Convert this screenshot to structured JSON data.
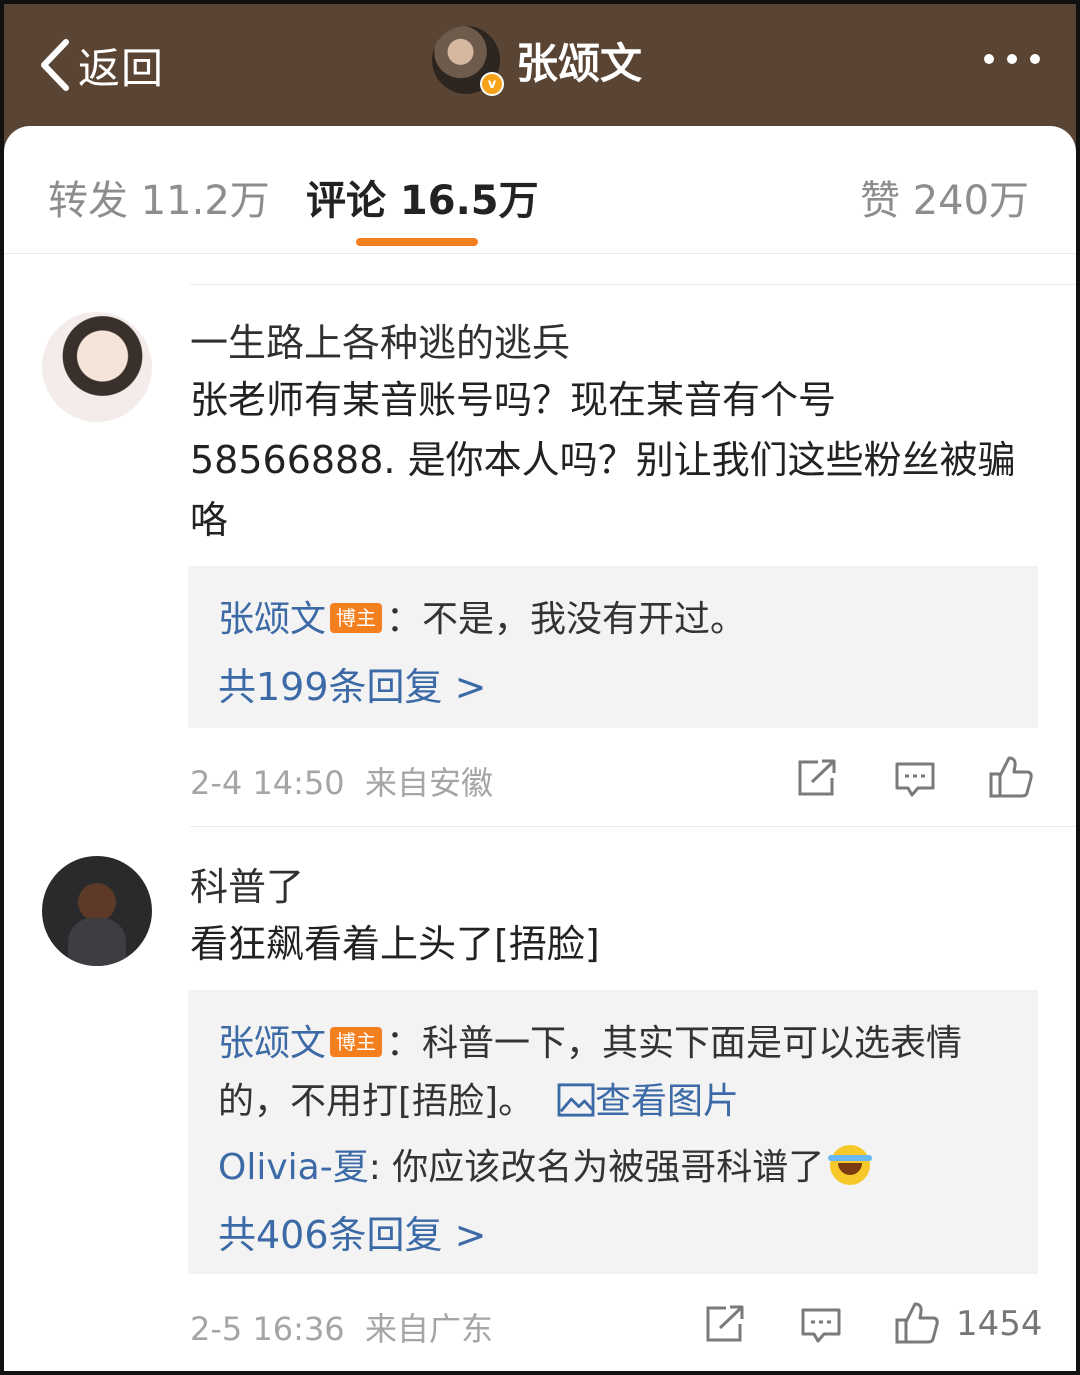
{
  "header": {
    "back_label": "返回",
    "profile_name": "张颂文",
    "verified_badge": "v"
  },
  "tabs": [
    {
      "label": "转发 11.2万"
    },
    {
      "label": "评论 16.5万"
    },
    {
      "label": "赞 240万"
    }
  ],
  "active_tab": "评论 16.5万",
  "comments": [
    {
      "username": "一生路上各种逃的逃兵",
      "content": "张老师有某音账号吗？现在某音有个号58566888. 是你本人吗？别让我们这些粉丝被骗咯",
      "reply_author": "张颂文",
      "reply_author_tag": "博主",
      "reply_text": "：不是，我没有开过。",
      "reply_count_link": "共199条回复 >",
      "timestamp": "2-4 14:50",
      "location": "来自安徽"
    },
    {
      "username": "科普了",
      "content": "看狂飙看着上头了[捂脸]",
      "reply_author": "张颂文",
      "reply_author_tag": "博主",
      "reply_text_line1": "：科普一下，其实下面是可以选表情",
      "reply_text_line2": "的，不用打[捂脸]。",
      "view_image_link": "查看图片",
      "sub_reply_author": "Olivia-夏",
      "sub_reply_text": ": 你应该改名为被强哥科谱了",
      "reply_count_link": "共406条回复 >",
      "timestamp": "2-5 16:36",
      "location": "来自广东",
      "like_count": "1454"
    }
  ],
  "colors": {
    "header_bg": "#5a4535",
    "accent": "#f47f1f",
    "link": "#3b6aa7"
  }
}
